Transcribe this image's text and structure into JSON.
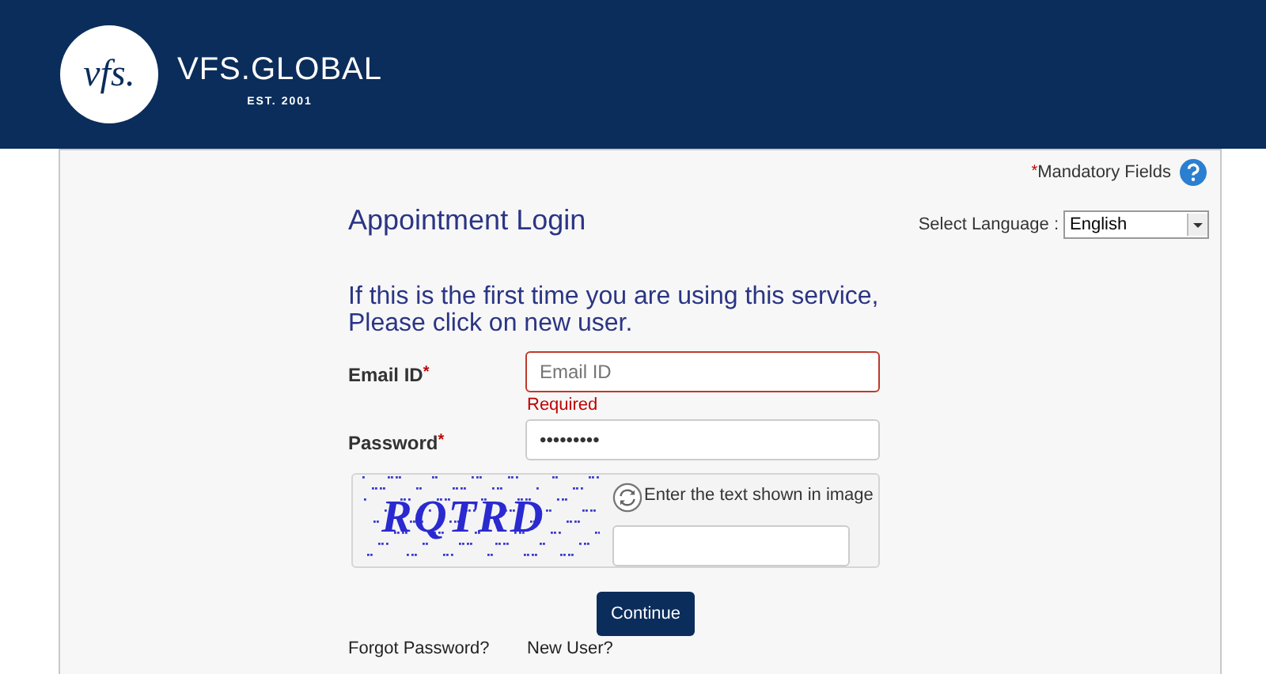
{
  "header": {
    "logo_mark": "vfs.",
    "brand": "VFS.GLOBAL",
    "tagline": "EST. 2001"
  },
  "mandatory_note": {
    "marker": "*",
    "text": "Mandatory Fields"
  },
  "title": "Appointment Login",
  "language": {
    "label": "Select Language :",
    "value": "English"
  },
  "intro": "If this is the first time you are using this service, Please click on new user.",
  "fields": [
    {
      "label": "Email ID",
      "required": true,
      "placeholder": "Email ID",
      "invalid": true,
      "error": "Required"
    },
    {
      "label": "Password",
      "required": true,
      "value": "•••••••••",
      "invalid": false
    }
  ],
  "captcha": {
    "image_text": "RQTRD",
    "prompt": "Enter the text shown in image"
  },
  "submit": "Continue",
  "links": [
    "Forgot Password?",
    "New User?"
  ]
}
